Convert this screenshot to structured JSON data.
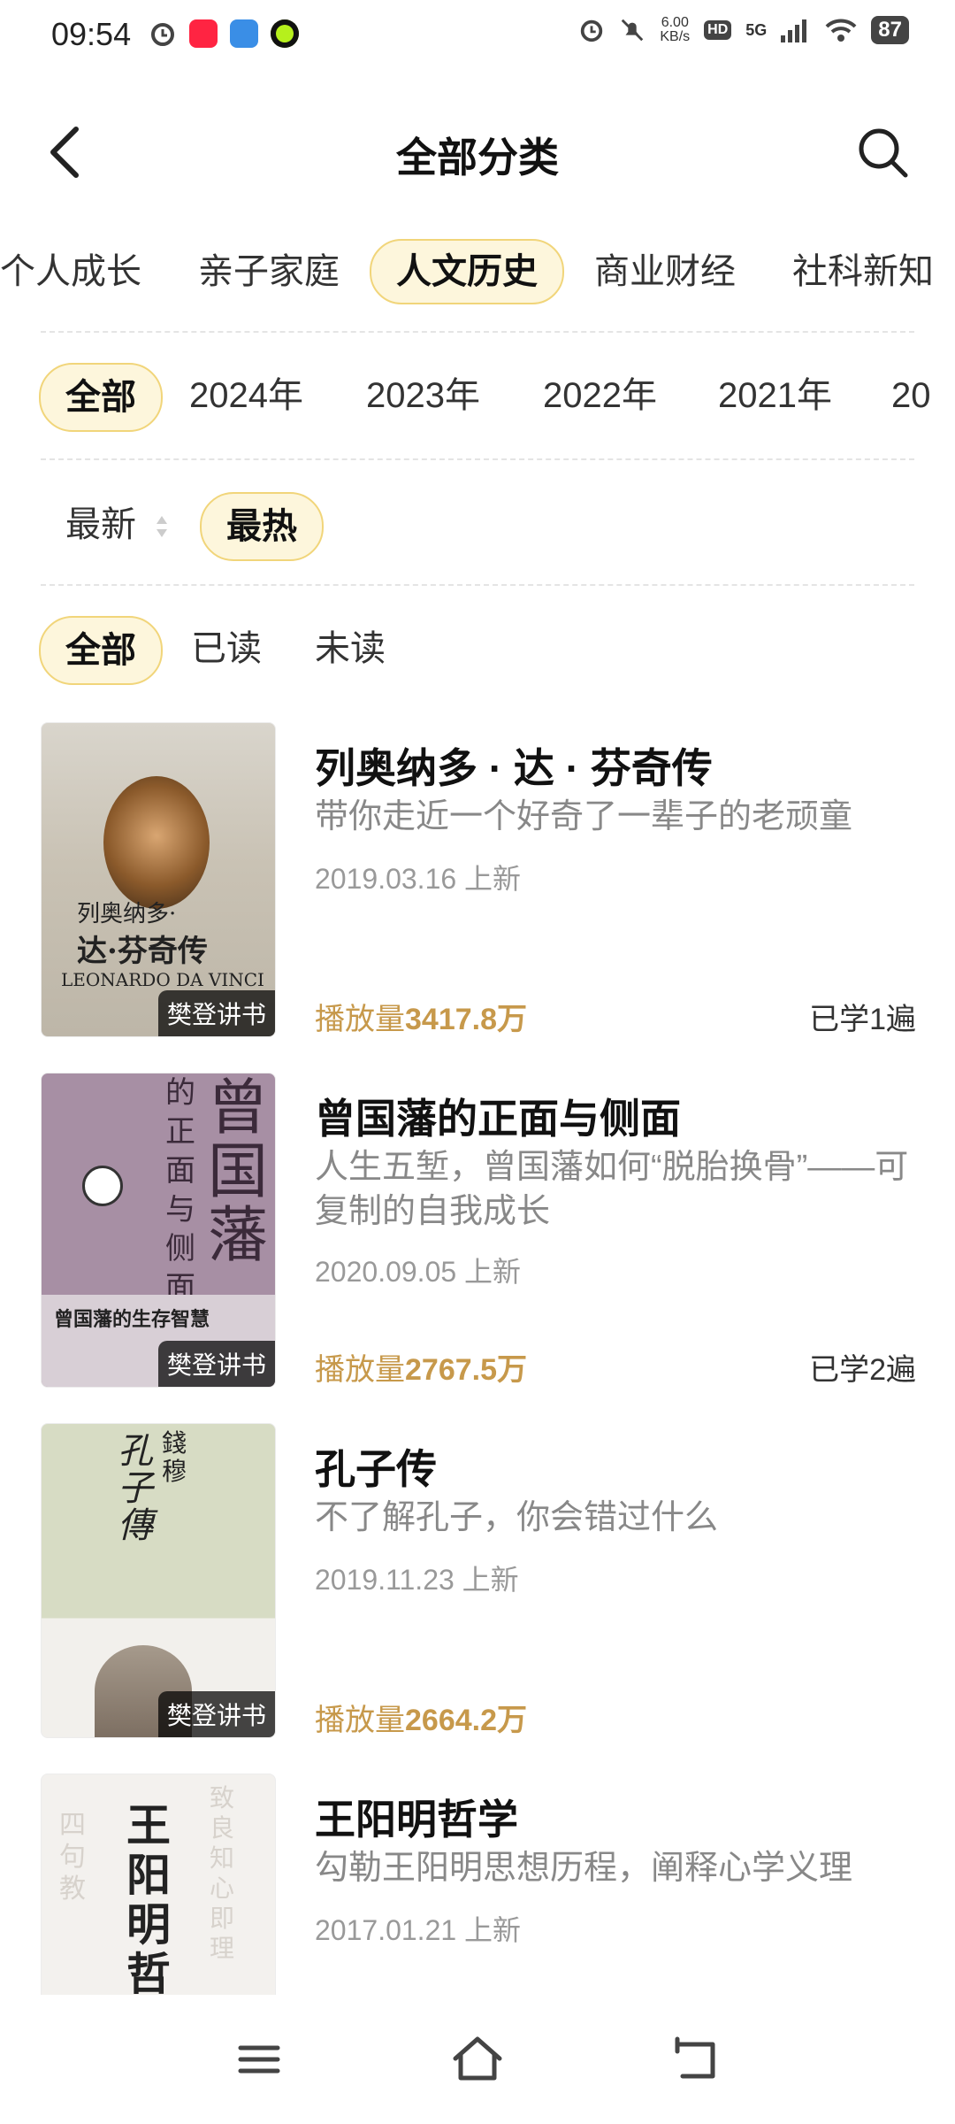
{
  "status_bar": {
    "time": "09:54",
    "net_speed_value": "6.00",
    "net_speed_unit": "KB/s",
    "hd_label": "HD",
    "signal_label": "5G",
    "battery": "87"
  },
  "header": {
    "title": "全部分类"
  },
  "category_tabs": [
    "个人成长",
    "亲子家庭",
    "人文历史",
    "商业财经",
    "社科新知"
  ],
  "year_chips": [
    "全部",
    "2024年",
    "2023年",
    "2022年",
    "2021年",
    "20"
  ],
  "sort": {
    "newest": "最新",
    "hottest": "最热"
  },
  "read_filter": [
    "全部",
    "已读",
    "未读"
  ],
  "books": [
    {
      "title": "列奥纳多 · 达 · 芬奇传",
      "desc": "带你走近一个好奇了一辈子的老顽童",
      "date": "2019.03.16 上新",
      "plays_label": "播放量",
      "plays_value": "3417.8万",
      "learned": "已学1遍",
      "badge": "樊登讲书",
      "cover_text": {
        "line1": "列奥纳多·",
        "line2": "达·芬奇传",
        "line3": "LEONARDO DA VINCI"
      }
    },
    {
      "title": "曾国藩的正面与侧面",
      "desc": "人生五堑，曾国藩如何“脱胎换骨”——可复制的自我成长",
      "date": "2020.09.05 上新",
      "plays_label": "播放量",
      "plays_value": "2767.5万",
      "learned": "已学2遍",
      "badge": "樊登讲书",
      "cover_text": {
        "big": "曾国藩",
        "side": "的正面与侧面",
        "bottom": "曾国藩的生存智慧"
      }
    },
    {
      "title": "孔子传",
      "desc": "不了解孔子，你会错过什么",
      "date": "2019.11.23 上新",
      "plays_label": "播放量",
      "plays_value": "2664.2万",
      "learned": "",
      "badge": "樊登讲书",
      "cover_text": {
        "title": "孔子傳",
        "author": "錢穆"
      }
    },
    {
      "title": "王阳明哲学",
      "desc": "勾勒王阳明思想历程，阐释心学义理",
      "date": "2017.01.21 上新",
      "cover_text": {
        "title": "王阳明哲学",
        "left": "四句教",
        "right": "致良知 心即理"
      }
    }
  ],
  "colors": {
    "accent_bg": "#fdf6dc",
    "accent_border": "#f1d57a",
    "plays": "#c7994b"
  }
}
